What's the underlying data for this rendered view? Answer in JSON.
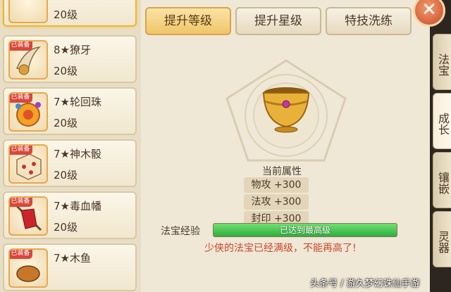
{
  "item_list": [
    {
      "name": "",
      "level": "20级",
      "equipped": false,
      "selected": true
    },
    {
      "name": "8★獠牙",
      "level": "20级",
      "equipped": true,
      "equipped_label": "已装备",
      "icon": "fang-icon"
    },
    {
      "name": "7★轮回珠",
      "level": "20级",
      "equipped": true,
      "equipped_label": "已装备",
      "icon": "orb-icon"
    },
    {
      "name": "7★神木骰",
      "level": "20级",
      "equipped": true,
      "equipped_label": "已装备",
      "icon": "dice-icon"
    },
    {
      "name": "7★毒血幡",
      "level": "20级",
      "equipped": true,
      "equipped_label": "已装备",
      "icon": "banner-icon"
    },
    {
      "name": "7★木鱼",
      "level": "",
      "equipped": true,
      "equipped_label": "已装备",
      "icon": "woodfish-icon"
    }
  ],
  "tabs": {
    "upgrade_level": "提升等级",
    "upgrade_star": "提升星级",
    "skill_refine": "特技洗练"
  },
  "attributes": {
    "title": "当前属性",
    "rows": [
      "物攻 +300",
      "法攻 +300",
      "封印 +300"
    ]
  },
  "experience": {
    "label": "法宝经验",
    "progress": 1.0,
    "bar_text": "已达到最高级",
    "max_message": "少侠的法宝已经满级，不能再高了!"
  },
  "side_tabs": {
    "treasure": "法宝",
    "growth": "成长",
    "inlay": "镶嵌",
    "spirit": "灵器"
  },
  "close_icon": "close-icon",
  "watermark": "头条号 / 游久梦幻诛仙手游",
  "colors": {
    "equipped_badge": "#d9473b",
    "exp_fill": "#2fae3f",
    "max_message": "#c9482a",
    "active_tab": "#efc66a"
  }
}
